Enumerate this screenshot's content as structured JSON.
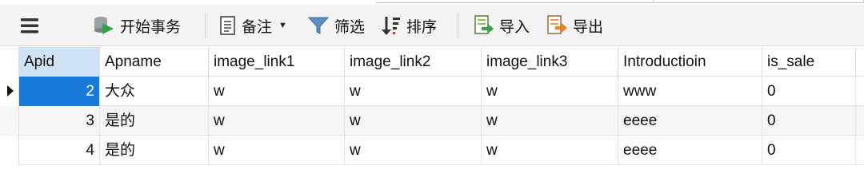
{
  "toolbar": {
    "menu_icon": "hamburger-menu-icon",
    "begin_transaction": "开始事务",
    "note": "备注",
    "filter": "筛选",
    "sort": "排序",
    "import": "导入",
    "export": "导出"
  },
  "table": {
    "columns": [
      "Apid",
      "Apname",
      "image_link1",
      "image_link2",
      "image_link3",
      "Introductioin",
      "is_sale"
    ],
    "rows": [
      [
        "2",
        "大众",
        "w",
        "w",
        "w",
        "www",
        "0"
      ],
      [
        "3",
        "是的",
        "w",
        "w",
        "w",
        "eeee",
        "0"
      ],
      [
        "4",
        "是的",
        "w",
        "w",
        "w",
        "eeee",
        "0"
      ]
    ],
    "selected_column": "Apid",
    "current_row_index": 0
  },
  "colors": {
    "selection": "#1a7ad8",
    "header_selected": "#cfe3f5",
    "toolbar_bg": "#f3f3f3"
  }
}
